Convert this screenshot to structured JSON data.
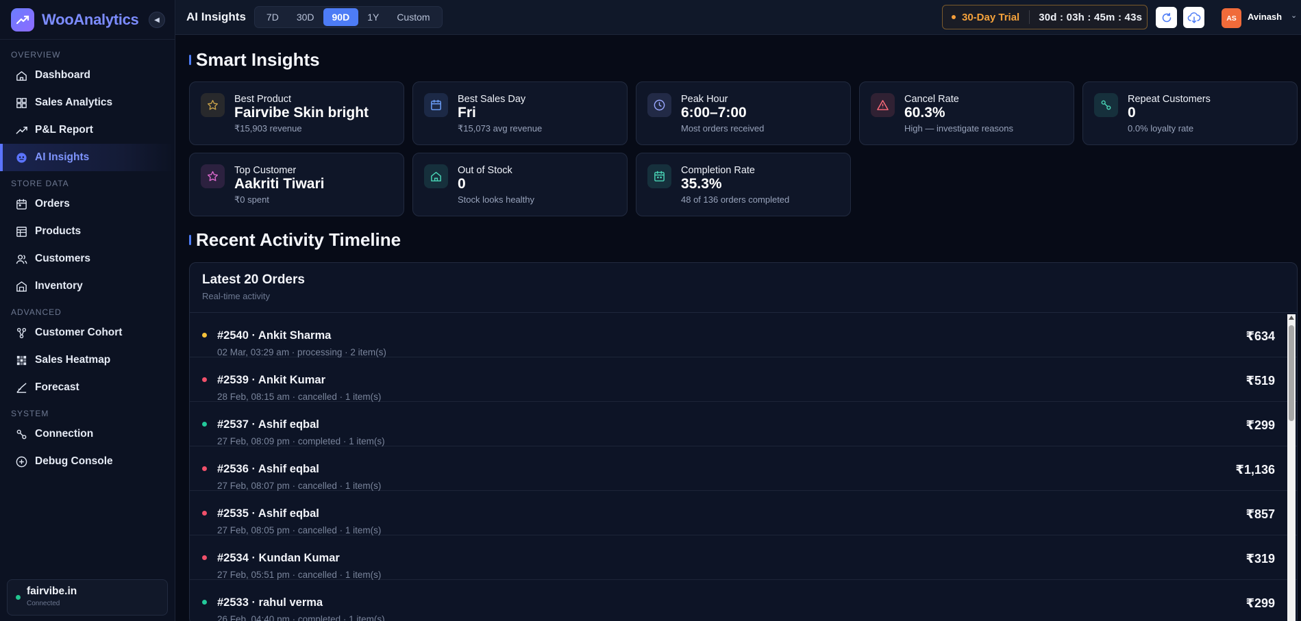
{
  "brand": {
    "name": "WooAnalytics"
  },
  "sidebar": {
    "sections": [
      {
        "title": "OVERVIEW",
        "items": [
          {
            "label": "Dashboard",
            "icon": "home-icon"
          },
          {
            "label": "Sales Analytics",
            "icon": "grid-icon"
          },
          {
            "label": "P&L Report",
            "icon": "trend-icon"
          },
          {
            "label": "AI Insights",
            "icon": "bot-icon",
            "active": true
          }
        ]
      },
      {
        "title": "STORE DATA",
        "items": [
          {
            "label": "Orders",
            "icon": "calendar-box-icon"
          },
          {
            "label": "Products",
            "icon": "table-icon"
          },
          {
            "label": "Customers",
            "icon": "users-icon"
          },
          {
            "label": "Inventory",
            "icon": "warehouse-icon"
          }
        ]
      },
      {
        "title": "ADVANCED",
        "items": [
          {
            "label": "Customer Cohort",
            "icon": "cohort-icon"
          },
          {
            "label": "Sales Heatmap",
            "icon": "heatmap-icon"
          },
          {
            "label": "Forecast",
            "icon": "forecast-icon"
          }
        ]
      },
      {
        "title": "SYSTEM",
        "items": [
          {
            "label": "Connection",
            "icon": "link-icon"
          },
          {
            "label": "Debug Console",
            "icon": "plus-circle-icon"
          }
        ]
      }
    ],
    "store": {
      "name": "fairvibe.in",
      "status": "Connected"
    }
  },
  "topbar": {
    "title": "AI Insights",
    "ranges": [
      "7D",
      "30D",
      "90D",
      "1Y",
      "Custom"
    ],
    "active_range": "90D",
    "trial_label": "30-Day Trial",
    "trial_timer": "30d : 03h : 45m : 43s",
    "user": {
      "initials": "AS",
      "name": "Avinash"
    }
  },
  "insights": {
    "title": "Smart Insights",
    "cards": [
      {
        "label": "Best Product",
        "value": "Fairvibe Skin bright",
        "sub": "₹15,903 revenue",
        "icon": "star-icon",
        "color": "#c9a24a"
      },
      {
        "label": "Best Sales Day",
        "value": "Fri",
        "sub": "₹15,073 avg revenue",
        "icon": "calendar-icon",
        "color": "#6ea2ff"
      },
      {
        "label": "Peak Hour",
        "value": "6:00–7:00",
        "sub": "Most orders received",
        "icon": "clock-icon",
        "color": "#9aa7ff"
      },
      {
        "label": "Cancel Rate",
        "value": "60.3%",
        "sub": "High — investigate reasons",
        "icon": "warning-icon",
        "color": "#ff6b7a"
      },
      {
        "label": "Repeat Customers",
        "value": "0",
        "sub": "0.0% loyalty rate",
        "icon": "link-icon",
        "color": "#4ad6b7"
      },
      {
        "label": "Top Customer",
        "value": "Aakriti Tiwari",
        "sub": "₹0 spent",
        "icon": "star-icon",
        "color": "#e06bd0"
      },
      {
        "label": "Out of Stock",
        "value": "0",
        "sub": "Stock looks healthy",
        "icon": "home-icon",
        "color": "#4ad6b7"
      },
      {
        "label": "Completion Rate",
        "value": "35.3%",
        "sub": "48 of 136 orders completed",
        "icon": "calendar-check-icon",
        "color": "#4ad6b7"
      }
    ]
  },
  "timeline": {
    "title": "Recent Activity Timeline",
    "panel_title": "Latest 20 Orders",
    "panel_sub": "Real-time activity",
    "orders": [
      {
        "title": "#2540 · Ankit Sharma",
        "meta": "02 Mar, 03:29 am · processing · 2 item(s)",
        "amount": "₹634",
        "status": "processing"
      },
      {
        "title": "#2539 · Ankit Kumar",
        "meta": "28 Feb, 08:15 am · cancelled · 1 item(s)",
        "amount": "₹519",
        "status": "cancelled"
      },
      {
        "title": "#2537 · Ashif eqbal",
        "meta": "27 Feb, 08:09 pm · completed · 1 item(s)",
        "amount": "₹299",
        "status": "completed"
      },
      {
        "title": "#2536 · Ashif eqbal",
        "meta": "27 Feb, 08:07 pm · cancelled · 1 item(s)",
        "amount": "₹1,136",
        "status": "cancelled"
      },
      {
        "title": "#2535 · Ashif eqbal",
        "meta": "27 Feb, 08:05 pm · cancelled · 1 item(s)",
        "amount": "₹857",
        "status": "cancelled"
      },
      {
        "title": "#2534 · Kundan Kumar",
        "meta": "27 Feb, 05:51 pm · cancelled · 1 item(s)",
        "amount": "₹319",
        "status": "cancelled"
      },
      {
        "title": "#2533 · rahul verma",
        "meta": "26 Feb, 04:40 pm · completed · 1 item(s)",
        "amount": "₹299",
        "status": "completed"
      }
    ],
    "status_colors": {
      "processing": "#f6c23a",
      "cancelled": "#f0506a",
      "completed": "#23c99a"
    }
  }
}
